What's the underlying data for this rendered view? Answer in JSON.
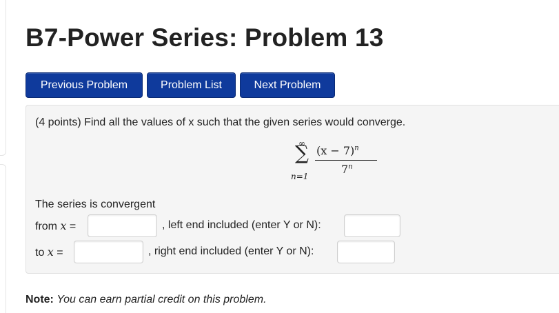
{
  "page": {
    "title": "B7-Power Series: Problem 13"
  },
  "nav": {
    "prev": "Previous Problem",
    "list": "Problem List",
    "next": "Next Problem"
  },
  "problem": {
    "intro": "(4 points) Find all the values of x such that the given series would converge.",
    "math": {
      "sum_upper": "∞",
      "sum_sign": "∑",
      "sum_lower": "n=1",
      "numerator_base": "(x − 7)",
      "numerator_exp": "n",
      "denominator_base": "7",
      "denominator_exp": "n"
    },
    "convergent_text": "The series is convergent",
    "from_label_prefix": "from ",
    "to_label_prefix": "to ",
    "var": "x",
    "eq": " =",
    "left_end_text": ", left end included (enter Y or N):",
    "right_end_text": ", right end included (enter Y or N):",
    "from_value": "",
    "left_included_value": "",
    "to_value": "",
    "right_included_value": ""
  },
  "note": {
    "label": "Note:",
    "text": "You can earn partial credit on this problem."
  },
  "colors": {
    "button": "#0f3a9c",
    "panel": "#f5f5f5"
  }
}
